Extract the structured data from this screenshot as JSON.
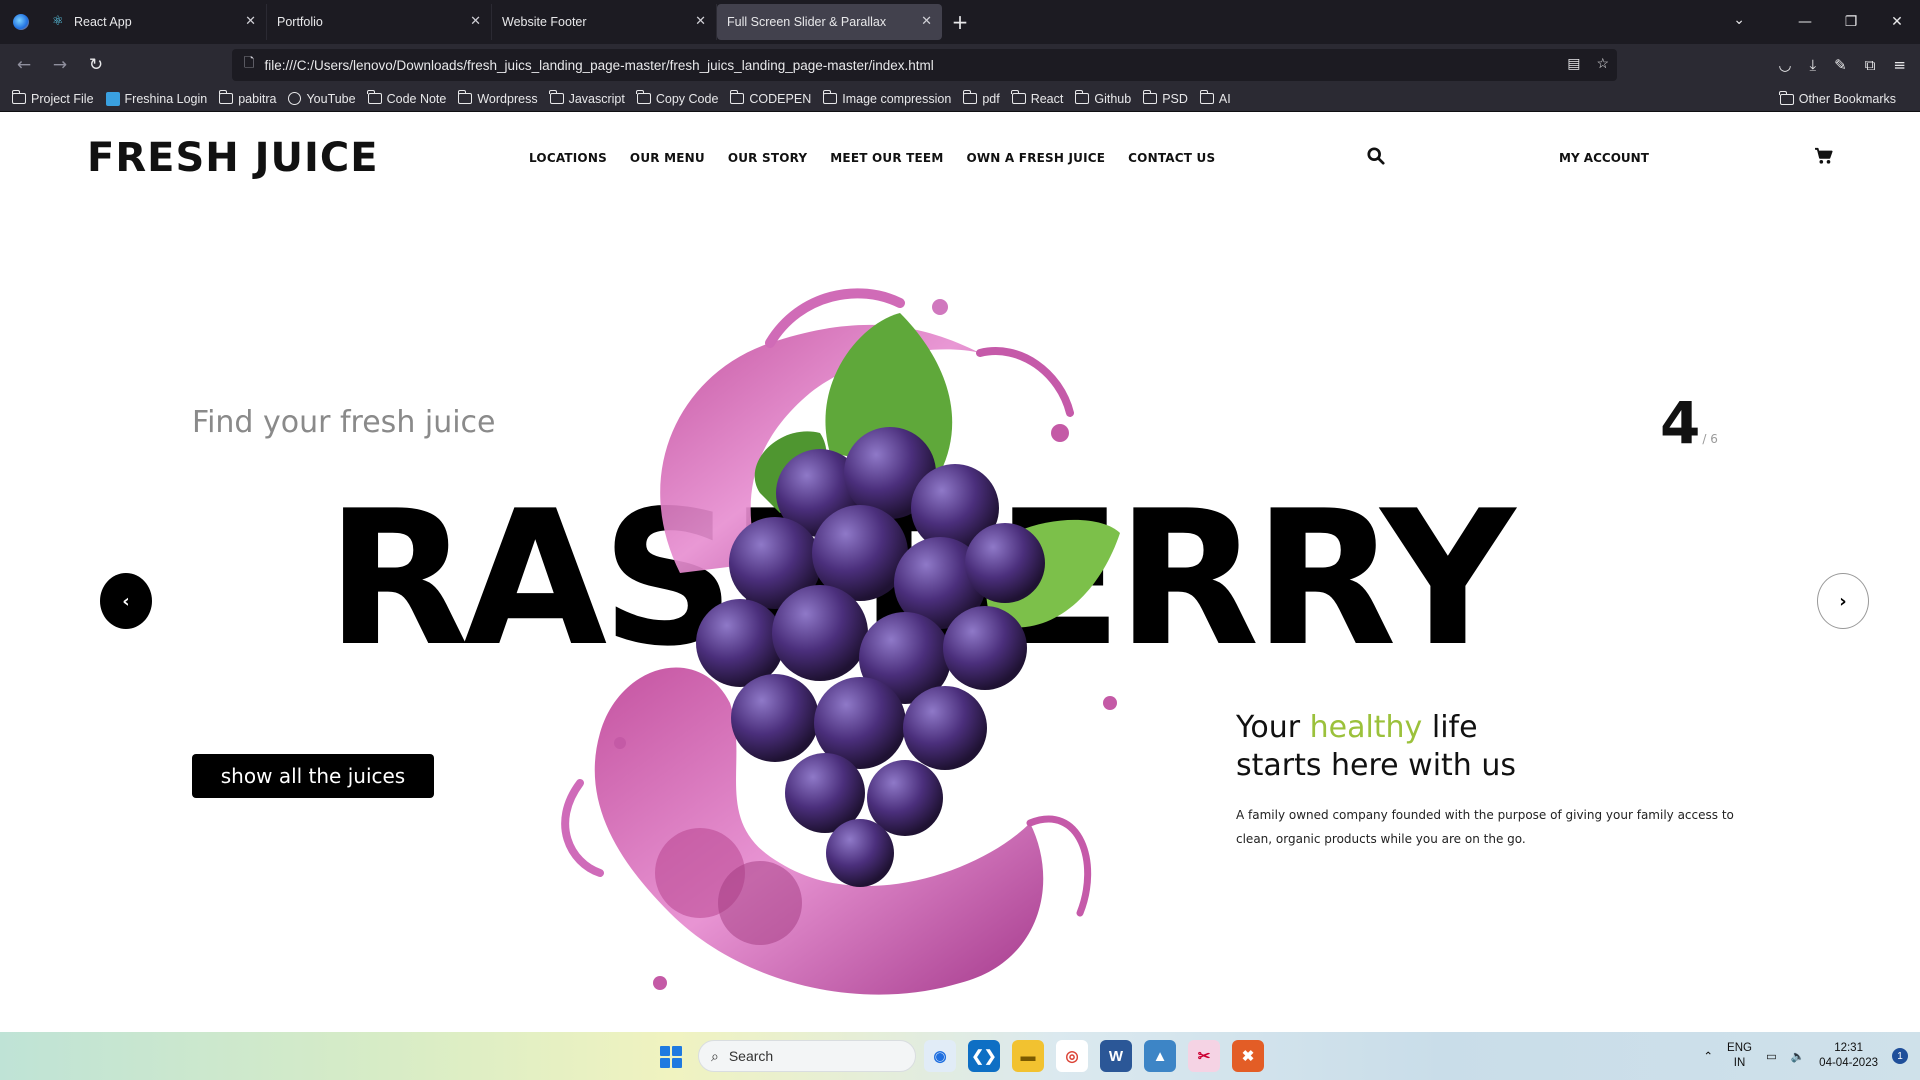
{
  "browser": {
    "tabs": [
      {
        "label": "React App",
        "icon": "react-icon"
      },
      {
        "label": "Portfolio",
        "icon": ""
      },
      {
        "label": "Website Footer",
        "icon": ""
      },
      {
        "label": "Full Screen Slider & Parallax",
        "icon": "",
        "active": true
      }
    ],
    "url": "file:///C:/Users/lenovo/Downloads/fresh_juics_landing_page-master/fresh_juics_landing_page-master/index.html",
    "bookmarks": [
      {
        "label": "Project File",
        "icon": "folder-icon"
      },
      {
        "label": "Freshina Login",
        "icon": "site-icon"
      },
      {
        "label": "pabitra",
        "icon": "folder-icon"
      },
      {
        "label": "YouTube",
        "icon": "globe-icon"
      },
      {
        "label": "Code Note",
        "icon": "folder-icon"
      },
      {
        "label": "Wordpress",
        "icon": "folder-icon"
      },
      {
        "label": "Javascript",
        "icon": "folder-icon"
      },
      {
        "label": "Copy Code",
        "icon": "folder-icon"
      },
      {
        "label": "CODEPEN",
        "icon": "folder-icon"
      },
      {
        "label": "Image compression",
        "icon": "folder-icon"
      },
      {
        "label": "pdf",
        "icon": "folder-icon"
      },
      {
        "label": "React",
        "icon": "folder-icon"
      },
      {
        "label": "Github",
        "icon": "folder-icon"
      },
      {
        "label": "PSD",
        "icon": "folder-icon"
      },
      {
        "label": "AI",
        "icon": "folder-icon"
      }
    ],
    "other_bookmarks": "Other Bookmarks"
  },
  "site": {
    "logo": "FRESH JUICE",
    "menu": [
      "LOCATIONS",
      "OUR MENU",
      "OUR STORY",
      "MEET OUR TEEM",
      "OWN A FRESH JUICE",
      "CONTACT US"
    ],
    "account": "MY ACCOUNT",
    "tagline": "Find your fresh juice",
    "slide_current": "4",
    "slide_total": "/ 6",
    "hero_word": "RASPBERRY",
    "cta": "show all the juices",
    "headline_part1": "Your ",
    "headline_green": "healthy",
    "headline_part2": " life",
    "headline_line2": "starts here with us",
    "description": "A family owned company founded with the purpose of giving your family access to clean, organic products while you are on the go.",
    "accent_color": "#9bc13b"
  },
  "taskbar": {
    "search_placeholder": "Search",
    "lang_line1": "ENG",
    "lang_line2": "IN",
    "time": "12:31",
    "date": "04-04-2023",
    "notification_count": "1"
  }
}
